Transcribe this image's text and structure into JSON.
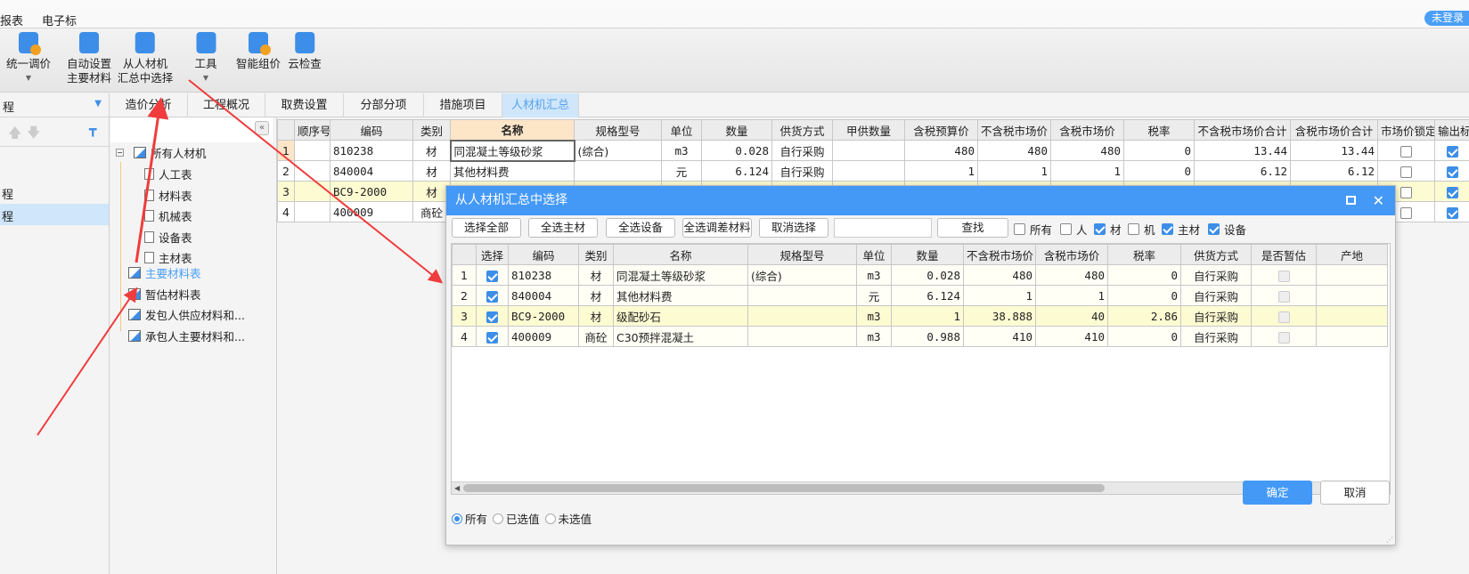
{
  "menu": {
    "items": [
      "报表",
      "电子标"
    ],
    "login": "未登录"
  },
  "toolbar": {
    "items": [
      {
        "label1": "统一调价",
        "label2": "",
        "dropdown": true,
        "icon": "unified-price-icon"
      },
      {
        "label1": "自动设置",
        "label2": "主要材料",
        "dropdown": false,
        "icon": "auto-set-icon"
      },
      {
        "label1": "从人材机",
        "label2": "汇总中选择",
        "dropdown": false,
        "icon": "select-from-summary-icon"
      },
      {
        "label1": "工具",
        "label2": "",
        "dropdown": true,
        "icon": "tools-icon"
      },
      {
        "label1": "智能组价",
        "label2": "",
        "dropdown": false,
        "icon": "smart-pricing-icon"
      },
      {
        "label1": "云检查",
        "label2": "",
        "dropdown": false,
        "icon": "cloud-check-icon"
      }
    ]
  },
  "left_panel": {
    "header": "程",
    "items": [
      "程",
      "程"
    ]
  },
  "tabs": [
    "造价分析",
    "工程概况",
    "取费设置",
    "分部分项",
    "措施项目",
    "人材机汇总"
  ],
  "tree": {
    "root": "所有人材机",
    "children": [
      "人工表",
      "材料表",
      "机械表",
      "设备表",
      "主材表"
    ],
    "others": [
      "主要材料表",
      "暂估材料表",
      "发包人供应材料和...",
      "承包人主要材料和..."
    ],
    "selected": "主要材料表"
  },
  "main_grid": {
    "columns": [
      "",
      "顺序号",
      "编码",
      "类别",
      "名称",
      "规格型号",
      "单位",
      "数量",
      "供货方式",
      "甲供数量",
      "含税预算价",
      "不含税市场价",
      "含税市场价",
      "税率",
      "不含税市场价合计",
      "含税市场价合计",
      "市场价锁定",
      "输出标"
    ],
    "rows": [
      {
        "cells": [
          "1",
          "",
          "810238",
          "材",
          "同混凝土等级砂浆",
          "(综合)",
          "m3",
          "0.028",
          "自行采购",
          "",
          "480",
          "480",
          "480",
          "0",
          "13.44",
          "13.44"
        ],
        "locked": false,
        "output": true
      },
      {
        "cells": [
          "2",
          "",
          "840004",
          "材",
          "其他材料费",
          "",
          "元",
          "6.124",
          "自行采购",
          "",
          "1",
          "1",
          "1",
          "0",
          "6.12",
          "6.12"
        ],
        "locked": false,
        "output": true
      },
      {
        "cells": [
          "3",
          "",
          "BC9-2000",
          "材",
          "",
          "",
          "",
          "",
          "",
          "",
          "",
          "",
          "",
          "",
          "",
          ""
        ],
        "locked": false,
        "output": true
      },
      {
        "cells": [
          "4",
          "",
          "400009",
          "商砼",
          "",
          "",
          "",
          "",
          "",
          "",
          "",
          "",
          "",
          "",
          "",
          ""
        ],
        "locked": false,
        "output": true
      }
    ]
  },
  "dialog": {
    "title": "从人材机汇总中选择",
    "buttons": [
      "选择全部",
      "全选主材",
      "全选设备",
      "全选调差材料",
      "取消选择"
    ],
    "search_value": "",
    "find": "查找",
    "filters": [
      {
        "label": "所有",
        "checked": false
      },
      {
        "label": "人",
        "checked": false
      },
      {
        "label": "材",
        "checked": true
      },
      {
        "label": "机",
        "checked": false
      },
      {
        "label": "主材",
        "checked": true
      },
      {
        "label": "设备",
        "checked": true
      }
    ],
    "columns": [
      "",
      "选择",
      "编码",
      "类别",
      "名称",
      "规格型号",
      "单位",
      "数量",
      "不含税市场价",
      "含税市场价",
      "税率",
      "供货方式",
      "是否暂估",
      "产地"
    ],
    "rows": [
      {
        "no": "1",
        "checked": true,
        "code": "810238",
        "type": "材",
        "name": "同混凝土等级砂浆",
        "spec": "(综合)",
        "unit": "m3",
        "qty": "0.028",
        "price_ex": "480",
        "price_in": "480",
        "tax": "0",
        "supply": "自行采购",
        "est": false,
        "origin": ""
      },
      {
        "no": "2",
        "checked": true,
        "code": "840004",
        "type": "材",
        "name": "其他材料费",
        "spec": "",
        "unit": "元",
        "qty": "6.124",
        "price_ex": "1",
        "price_in": "1",
        "tax": "0",
        "supply": "自行采购",
        "est": false,
        "origin": ""
      },
      {
        "no": "3",
        "checked": true,
        "code": "BC9-2000",
        "type": "材",
        "name": "级配砂石",
        "spec": "",
        "unit": "m3",
        "qty": "1",
        "price_ex": "38.888",
        "price_in": "40",
        "tax": "2.86",
        "supply": "自行采购",
        "est": false,
        "origin": ""
      },
      {
        "no": "4",
        "checked": true,
        "code": "400009",
        "type": "商砼",
        "name": "C30预拌混凝土",
        "spec": "",
        "unit": "m3",
        "qty": "0.988",
        "price_ex": "410",
        "price_in": "410",
        "tax": "0",
        "supply": "自行采购",
        "est": false,
        "origin": ""
      }
    ],
    "radios": [
      {
        "label": "所有",
        "selected": true
      },
      {
        "label": "已选值",
        "selected": false
      },
      {
        "label": "未选值",
        "selected": false
      }
    ],
    "ok": "确定",
    "cancel": "取消"
  },
  "colors": {
    "accent": "#4499f7",
    "annotation": "#f03c3c",
    "highlight_row": "#fdfbd2"
  }
}
